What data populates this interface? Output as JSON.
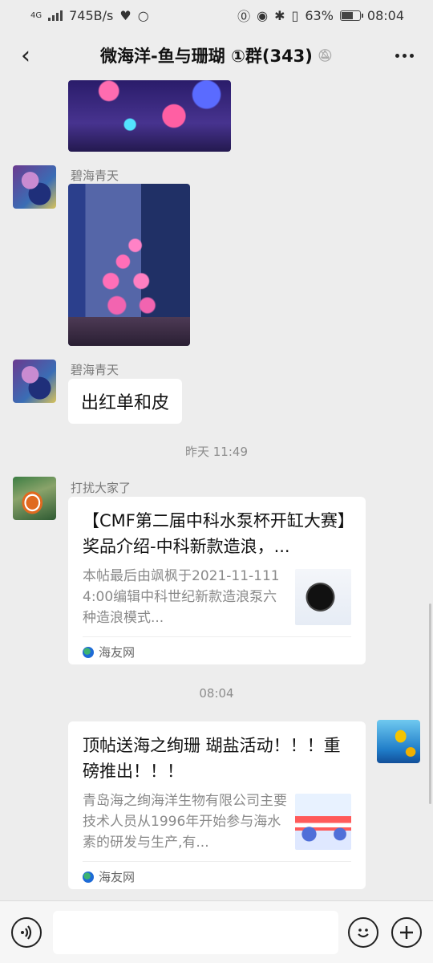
{
  "status": {
    "network": "4G",
    "speed": "745B/s",
    "battery": "63%",
    "time": "08:04"
  },
  "header": {
    "title": "微海洋-鱼与珊瑚 ①群(343)"
  },
  "messages": {
    "m1": {
      "nickname": "碧海青天"
    },
    "m2": {
      "nickname": "碧海青天",
      "text": "出红单和皮"
    },
    "time1": "昨天 11:49",
    "m3": {
      "nickname": "打扰大家了",
      "card_title": "【CMF第二届中科水泵杯开缸大赛】奖品介绍-中科新款造浪，...",
      "card_desc": "本帖最后由飒枫于2021-11-1114:00编辑中科世纪新款造浪泵六种造浪模式...",
      "source": "海友网"
    },
    "time2": "08:04",
    "m4": {
      "card_title": "顶帖送海之绚珊 瑚盐活动！！！重磅推出！！！",
      "card_desc": "青岛海之绚海洋生物有限公司主要技术人员从1996年开始参与海水素的研发与生产,有...",
      "source": "海友网"
    }
  }
}
